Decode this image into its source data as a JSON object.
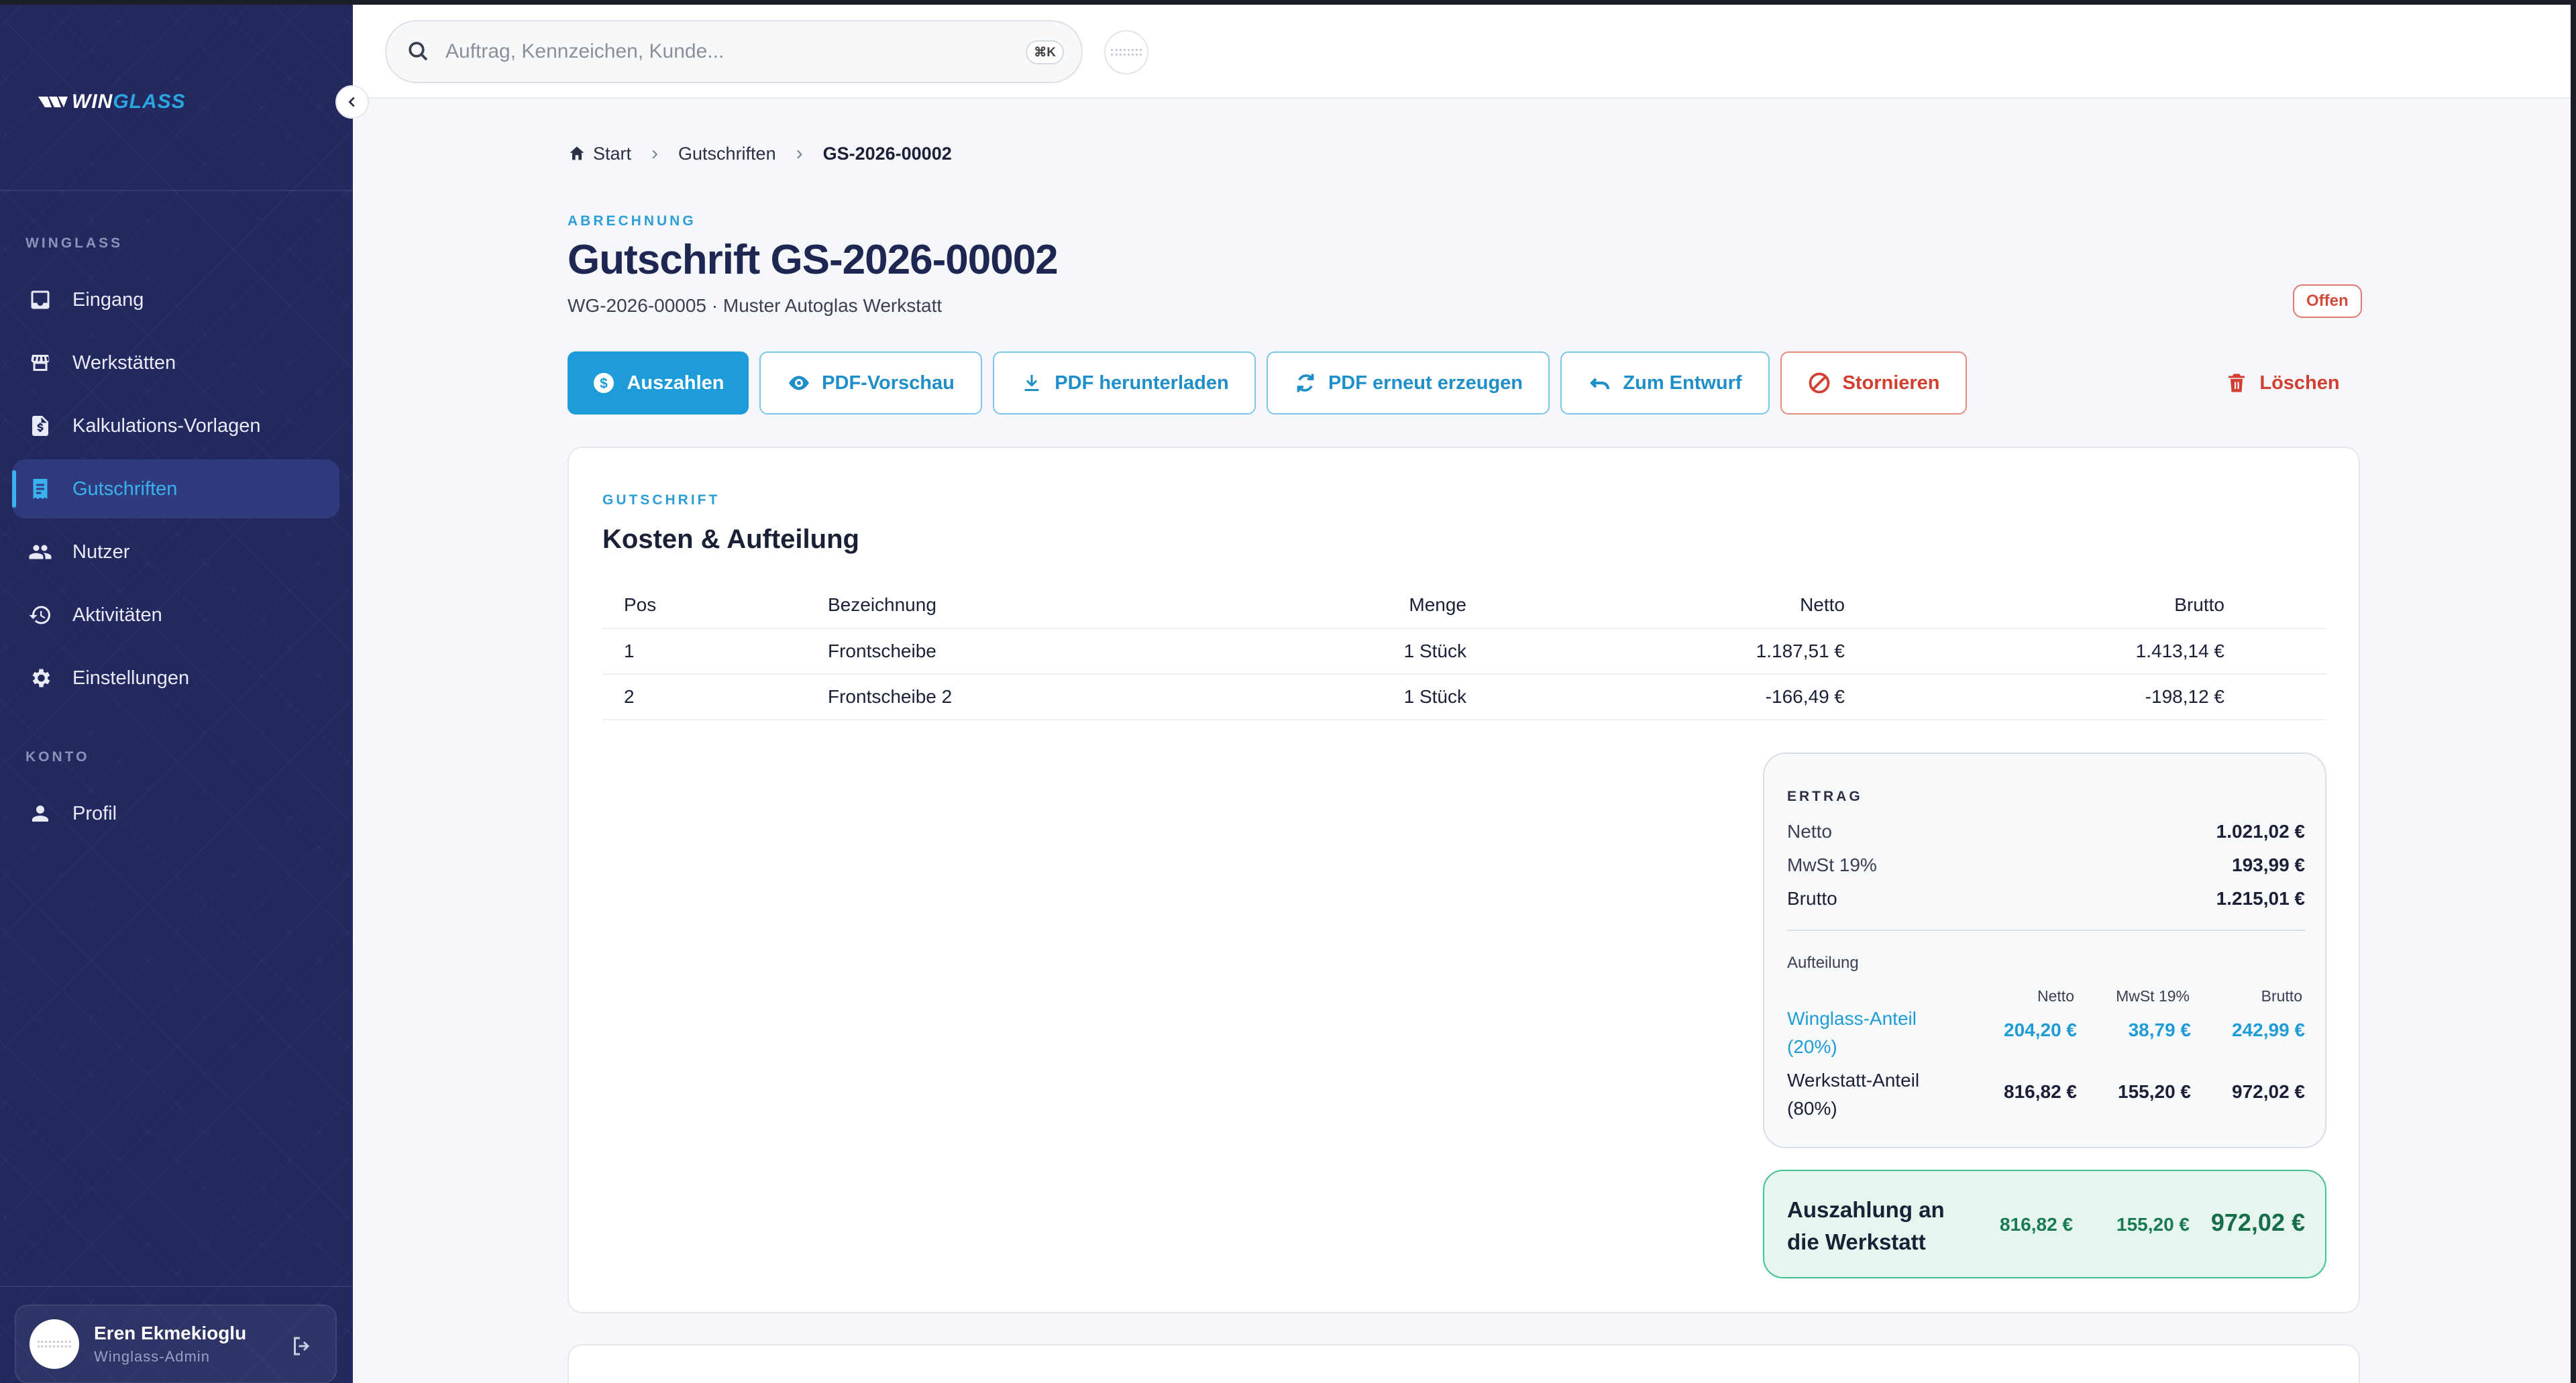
{
  "sidebar": {
    "logo": {
      "part1": "WIN",
      "part2": "GLASS"
    },
    "section_winglass": "WINGLASS",
    "items": [
      {
        "label": "Eingang",
        "icon": "inbox-icon"
      },
      {
        "label": "Werkstätten",
        "icon": "store-icon"
      },
      {
        "label": "Kalkulations-Vorlagen",
        "icon": "file-dollar-icon"
      },
      {
        "label": "Gutschriften",
        "icon": "receipt-icon",
        "active": true
      },
      {
        "label": "Nutzer",
        "icon": "users-icon"
      },
      {
        "label": "Aktivitäten",
        "icon": "history-icon"
      },
      {
        "label": "Einstellungen",
        "icon": "gear-icon"
      }
    ],
    "section_konto": "KONTO",
    "konto_items": [
      {
        "label": "Profil",
        "icon": "person-icon"
      }
    ],
    "user": {
      "name": "Eren Ekmekioglu",
      "role": "Winglass-Admin"
    }
  },
  "topbar": {
    "search_placeholder": "Auftrag, Kennzeichen, Kunde...",
    "shortcut": "⌘K"
  },
  "breadcrumb": {
    "home": "Start",
    "section": "Gutschriften",
    "current": "GS-2026-00002"
  },
  "header": {
    "eyebrow": "ABRECHNUNG",
    "title": "Gutschrift GS-2026-00002",
    "subtitle": "WG-2026-00005 · Muster Autoglas Werkstatt",
    "status": "Offen"
  },
  "actions": {
    "pay": "Auszahlen",
    "preview": "PDF-Vorschau",
    "download": "PDF herunterladen",
    "regenerate": "PDF erneut erzeugen",
    "to_draft": "Zum Entwurf",
    "cancel": "Stornieren",
    "delete": "Löschen"
  },
  "card": {
    "eyebrow": "GUTSCHRIFT",
    "title": "Kosten & Aufteilung",
    "columns": {
      "pos": "Pos",
      "bez": "Bezeichnung",
      "menge": "Menge",
      "netto": "Netto",
      "brutto": "Brutto"
    },
    "rows": [
      {
        "pos": "1",
        "bez": "Frontscheibe",
        "menge": "1 Stück",
        "netto": "1.187,51 €",
        "brutto": "1.413,14 €"
      },
      {
        "pos": "2",
        "bez": "Frontscheibe 2",
        "menge": "1 Stück",
        "netto": "-166,49 €",
        "brutto": "-198,12 €"
      }
    ]
  },
  "ertrag": {
    "eyebrow": "ERTRAG",
    "netto_label": "Netto",
    "netto": "1.021,02 €",
    "mwst_label": "MwSt 19%",
    "mwst": "193,99 €",
    "brutto_label": "Brutto",
    "brutto": "1.215,01 €",
    "split_label": "Aufteilung",
    "split_cols": {
      "netto": "Netto",
      "mwst": "MwSt 19%",
      "brutto": "Brutto"
    },
    "winglass": {
      "name": "Winglass-Anteil (20%)",
      "netto": "204,20 €",
      "mwst": "38,79 €",
      "brutto": "242,99 €"
    },
    "werkstatt": {
      "name": "Werkstatt-Anteil (80%)",
      "netto": "816,82 €",
      "mwst": "155,20 €",
      "brutto": "972,02 €"
    }
  },
  "payout": {
    "label": "Auszahlung an die Werkstatt",
    "netto": "816,82 €",
    "mwst": "155,20 €",
    "brutto": "972,02 €"
  }
}
